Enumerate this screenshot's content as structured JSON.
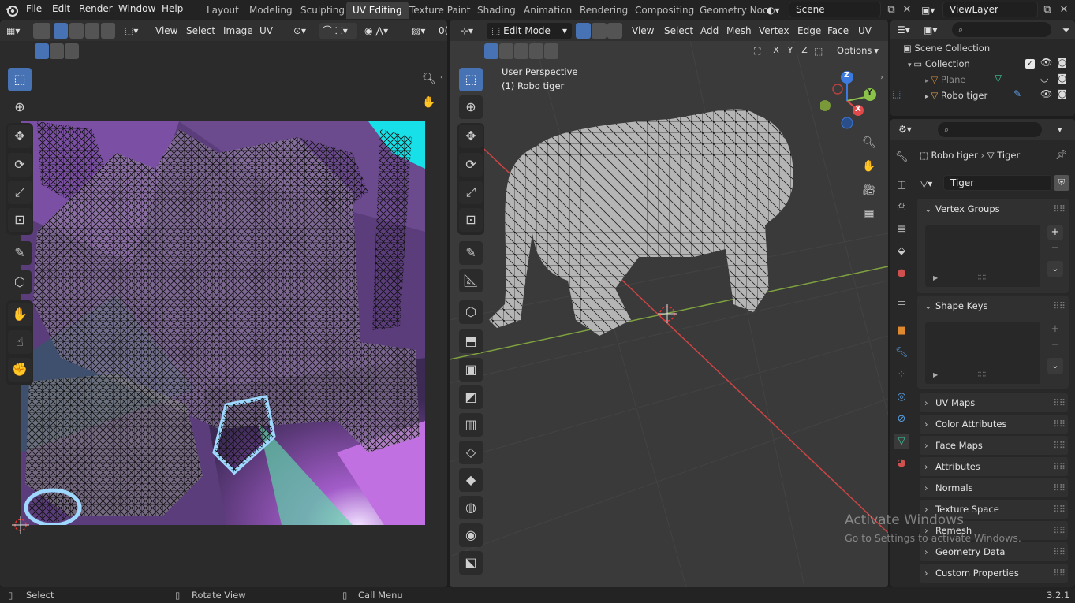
{
  "menus": [
    "File",
    "Edit",
    "Render",
    "Window",
    "Help"
  ],
  "workspaces": [
    "Layout",
    "Modeling",
    "Sculpting",
    "UV Editing",
    "Texture Paint",
    "Shading",
    "Animation",
    "Rendering",
    "Compositing",
    "Geometry Noc"
  ],
  "active_workspace": "UV Editing",
  "scene_name": "Scene",
  "view_layer": "ViewLayer",
  "uv_header": {
    "menus": [
      "View",
      "Select",
      "Image",
      "UV"
    ],
    "partial": "0("
  },
  "viewport_header": {
    "mode": "Edit Mode",
    "menus": [
      "View",
      "Select",
      "Add",
      "Mesh",
      "Vertex",
      "Edge",
      "Face",
      "UV"
    ],
    "options": "Options",
    "axes": [
      "X",
      "Y",
      "Z"
    ]
  },
  "viewport_overlay": {
    "line1": "User Perspective",
    "line2": "(1) Robo tiger"
  },
  "gizmo": {
    "z": "Z",
    "y": "Y",
    "x": "X"
  },
  "outliner": {
    "root": "Scene Collection",
    "collection": "Collection",
    "items": [
      "Plane",
      "Robo tiger"
    ]
  },
  "properties": {
    "object": "Robo tiger",
    "data": "Tiger",
    "mesh_name": "Tiger",
    "vertex_groups": "Vertex Groups",
    "shape_keys": "Shape Keys",
    "sections": [
      "UV Maps",
      "Color Attributes",
      "Face Maps",
      "Attributes",
      "Normals",
      "Texture Space",
      "Remesh",
      "Geometry Data",
      "Custom Properties"
    ]
  },
  "watermark": {
    "title": "Activate Windows",
    "sub": "Go to Settings to activate Windows."
  },
  "status": {
    "select": "Select",
    "rotate": "Rotate View",
    "menu": "Call Menu",
    "version": "3.2.1"
  },
  "colors": {
    "accent": "#4772b3",
    "x_axis": "#e04a4a",
    "y_axis": "#8bc34a",
    "z_axis": "#3d7ae0"
  }
}
